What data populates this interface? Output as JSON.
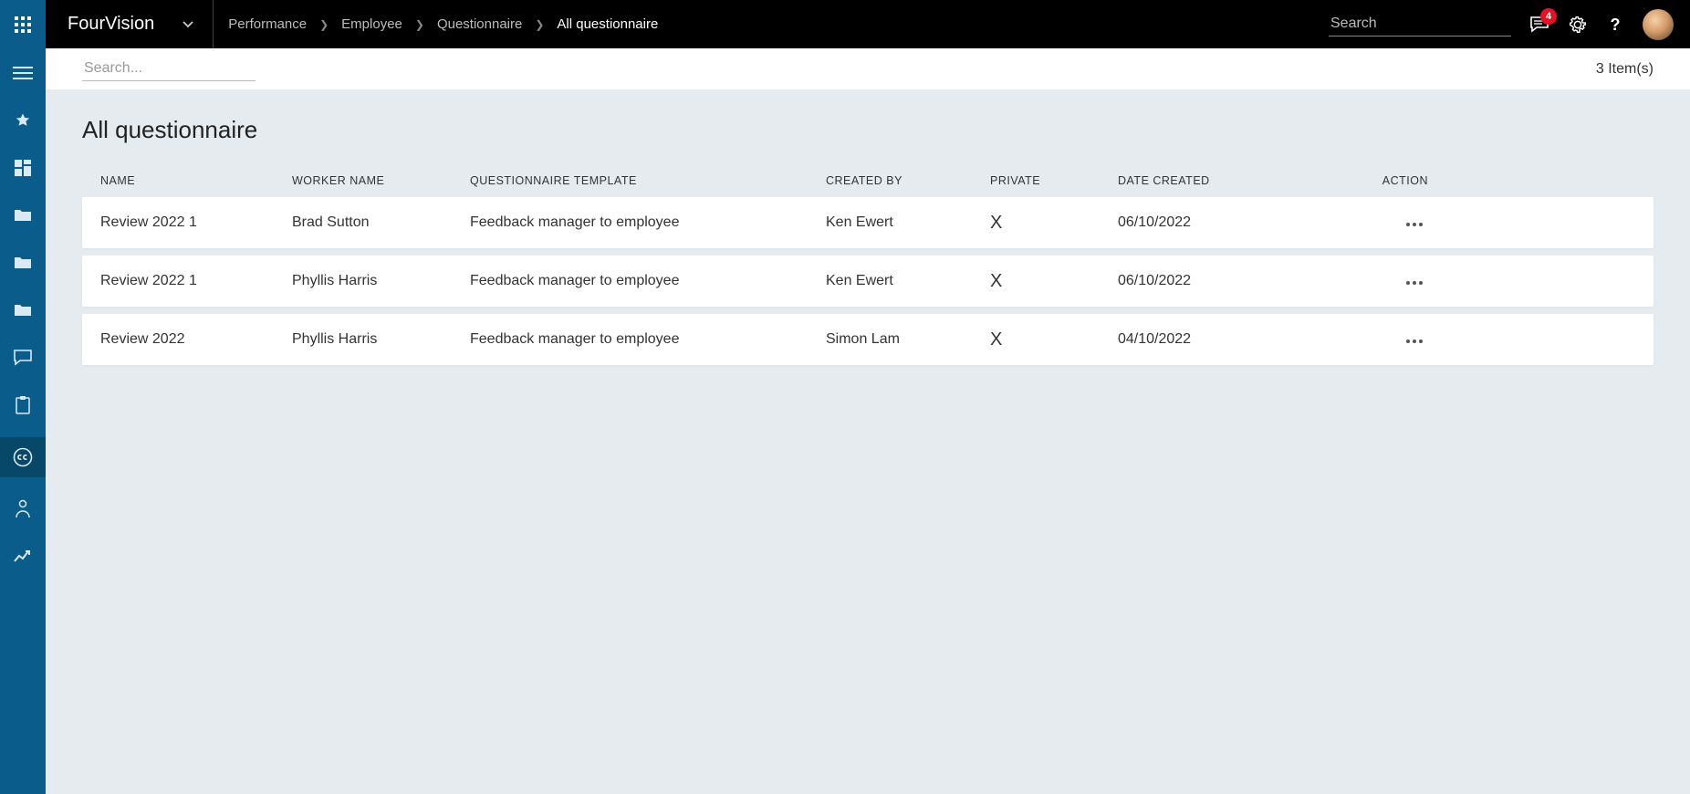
{
  "header": {
    "brand": "FourVision",
    "breadcrumb": [
      "Performance",
      "Employee",
      "Questionnaire",
      "All questionnaire"
    ],
    "search_placeholder": "Search",
    "notification_count": "4"
  },
  "toolbar": {
    "search_placeholder": "Search...",
    "item_count": "3 Item(s)"
  },
  "page": {
    "title": "All questionnaire",
    "columns": {
      "name": "NAME",
      "worker": "WORKER NAME",
      "template": "QUESTIONNAIRE TEMPLATE",
      "created_by": "CREATED BY",
      "private": "PRIVATE",
      "date": "DATE CREATED",
      "action": "ACTION"
    },
    "rows": [
      {
        "name": "Review 2022 1",
        "worker": "Brad Sutton",
        "template": "Feedback manager to employee",
        "created_by": "Ken Ewert",
        "private": "X",
        "date": "06/10/2022"
      },
      {
        "name": "Review 2022 1",
        "worker": "Phyllis Harris",
        "template": "Feedback manager to employee",
        "created_by": "Ken Ewert",
        "private": "X",
        "date": "06/10/2022"
      },
      {
        "name": "Review 2022",
        "worker": "Phyllis Harris",
        "template": "Feedback manager to employee",
        "created_by": "Simon Lam",
        "private": "X",
        "date": "04/10/2022"
      }
    ]
  },
  "sidebar_icons": [
    "menu",
    "star",
    "dashboard",
    "folder",
    "folder",
    "folder",
    "chat",
    "clipboard",
    "cc",
    "person",
    "trend"
  ]
}
